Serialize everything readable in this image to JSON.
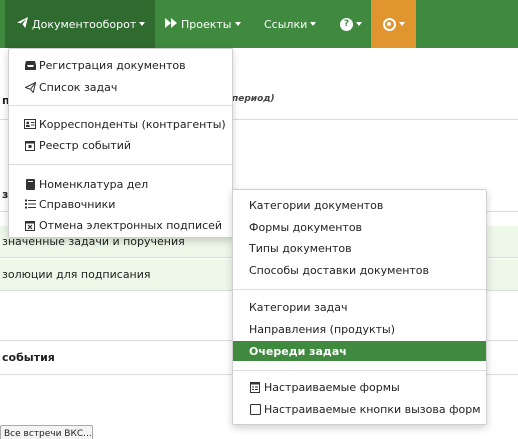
{
  "nav": {
    "documents": "Документооборот",
    "projects": "Проекты",
    "links": "Ссылки",
    "help": "?"
  },
  "page": {
    "header_fragment": "п",
    "period_fragment": "период)",
    "section_fragment": "з",
    "row_tasks": "значенные задачи и поручения",
    "row_resolutions": "золюции для подписания",
    "events_heading": "события",
    "button_label": "Все встречи ВКС..."
  },
  "docs_menu": {
    "items": [
      {
        "label": "Регистрация документов",
        "icon": "inbox-icon"
      },
      {
        "label": "Список задач",
        "icon": "paper-plane-icon"
      },
      {
        "label": "Корреспонденты (контрагенты)",
        "icon": "address-card-icon"
      },
      {
        "label": "Реестр событий",
        "icon": "calendar-icon"
      },
      {
        "label": "Номенклатура дел",
        "icon": "book-icon"
      },
      {
        "label": "Справочники",
        "icon": "list-icon"
      },
      {
        "label": "Отмена электронных подписей",
        "icon": "calendar-x-icon"
      }
    ]
  },
  "sub_menu": {
    "items": [
      {
        "label": "Категории документов"
      },
      {
        "label": "Формы документов"
      },
      {
        "label": "Типы документов"
      },
      {
        "label": "Способы доставки документов"
      },
      {
        "label": "Категории задач"
      },
      {
        "label": "Направления (продукты)"
      },
      {
        "label": "Очереди задач"
      },
      {
        "label": "Настраиваемые формы",
        "icon": "form-icon"
      },
      {
        "label": "Настраиваемые кнопки вызова форм",
        "icon": "square-icon"
      }
    ],
    "active_label": "Очереди задач"
  },
  "colors": {
    "navbar": "#3f8a3f",
    "active_nav": "#2f6a2f",
    "support": "#e0952e",
    "active_item": "#3f8a3f",
    "green_row": "#eef8e8"
  }
}
